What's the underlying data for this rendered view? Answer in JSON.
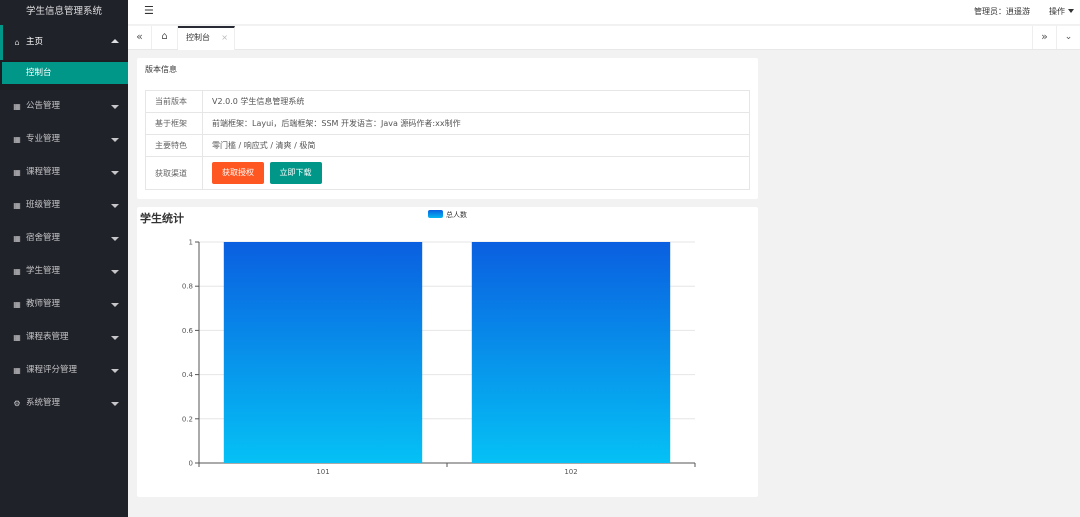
{
  "app": {
    "title": "学生信息管理系统"
  },
  "sidebar": {
    "home": {
      "label": "主页",
      "icon": "home-icon"
    },
    "home_sub": [
      {
        "label": "控制台"
      }
    ],
    "items": [
      {
        "label": "公告管理",
        "icon": "grid-icon"
      },
      {
        "label": "专业管理",
        "icon": "grid-icon"
      },
      {
        "label": "课程管理",
        "icon": "grid-icon"
      },
      {
        "label": "班级管理",
        "icon": "grid-icon"
      },
      {
        "label": "宿舍管理",
        "icon": "grid-icon"
      },
      {
        "label": "学生管理",
        "icon": "grid-icon"
      },
      {
        "label": "教师管理",
        "icon": "grid-icon"
      },
      {
        "label": "课程表管理",
        "icon": "grid-icon"
      },
      {
        "label": "课程评分管理",
        "icon": "grid-icon"
      },
      {
        "label": "系统管理",
        "icon": "gear-icon"
      }
    ]
  },
  "header": {
    "admin_label": "管理员：逍遥游",
    "ops_label": "操作"
  },
  "tabs": {
    "active": {
      "label": "控制台",
      "close": "×"
    }
  },
  "version_card": {
    "title": "版本信息",
    "rows": [
      {
        "key": "当前版本",
        "value": "V2.0.0 学生信息管理系统"
      },
      {
        "key": "基于框架",
        "value": "前端框架：Layui，后端框架：SSM 开发语言：Java 源码作者:xx制作"
      },
      {
        "key": "主要特色",
        "value": "零门槛 / 响应式 / 清爽 / 极简"
      }
    ],
    "action_row": {
      "key": "获取渠道",
      "btn_license": "获取授权",
      "btn_download": "立即下载"
    }
  },
  "chart_data": {
    "type": "bar",
    "title": "学生统计",
    "categories": [
      "101",
      "102"
    ],
    "series": [
      {
        "name": "总人数",
        "values": [
          1,
          1
        ]
      }
    ],
    "ylim": [
      0,
      1
    ],
    "yticks": [
      "0",
      "0.2",
      "0.4",
      "0.6",
      "0.8",
      "1"
    ],
    "grid": true,
    "legend": "top-center",
    "colors": {
      "bar_top": "#0a5fe0",
      "bar_bottom": "#05c1f5"
    }
  }
}
